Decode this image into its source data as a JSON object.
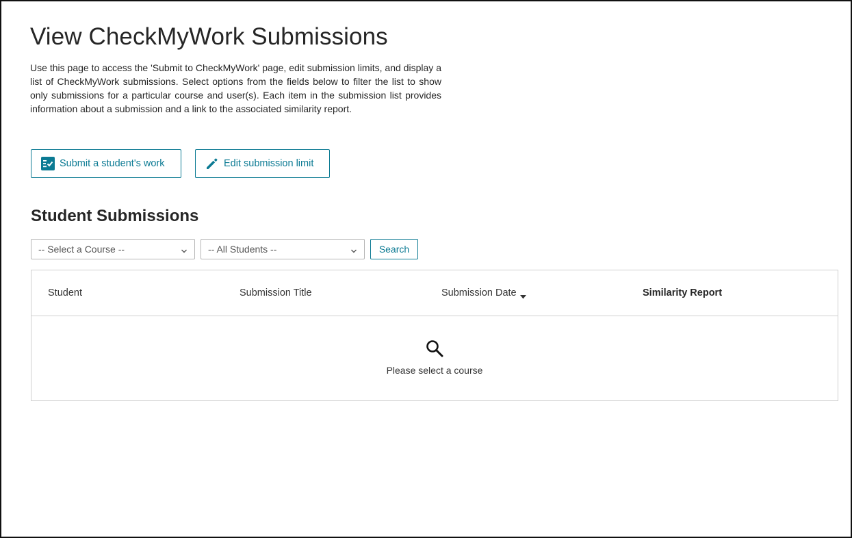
{
  "page": {
    "title": "View CheckMyWork Submissions",
    "intro": "Use this page to access the 'Submit to CheckMyWork' page, edit submission limits, and display a list of CheckMyWork submissions. Select options from the fields below to filter the list to show only submissions for a particular course and user(s). Each item in the submission list provides information about a submission and a link to the associated similarity report."
  },
  "actions": {
    "submit_label": "Submit a student's work",
    "submit_icon": "checklist-icon",
    "edit_label": "Edit submission limit",
    "edit_icon": "pencil-icon"
  },
  "section": {
    "title": "Student Submissions"
  },
  "filters": {
    "course_selected": "-- Select a Course --",
    "students_selected": "-- All Students --",
    "search_label": "Search"
  },
  "table": {
    "columns": [
      "Student",
      "Submission Title",
      "Submission Date",
      "Similarity Report"
    ],
    "sorted_column": "Submission Date",
    "empty_message": "Please select a course",
    "empty_icon": "magnifier-icon"
  },
  "colors": {
    "accent": "#0b7a93",
    "text": "#262626",
    "border": "#cfcfcf"
  }
}
